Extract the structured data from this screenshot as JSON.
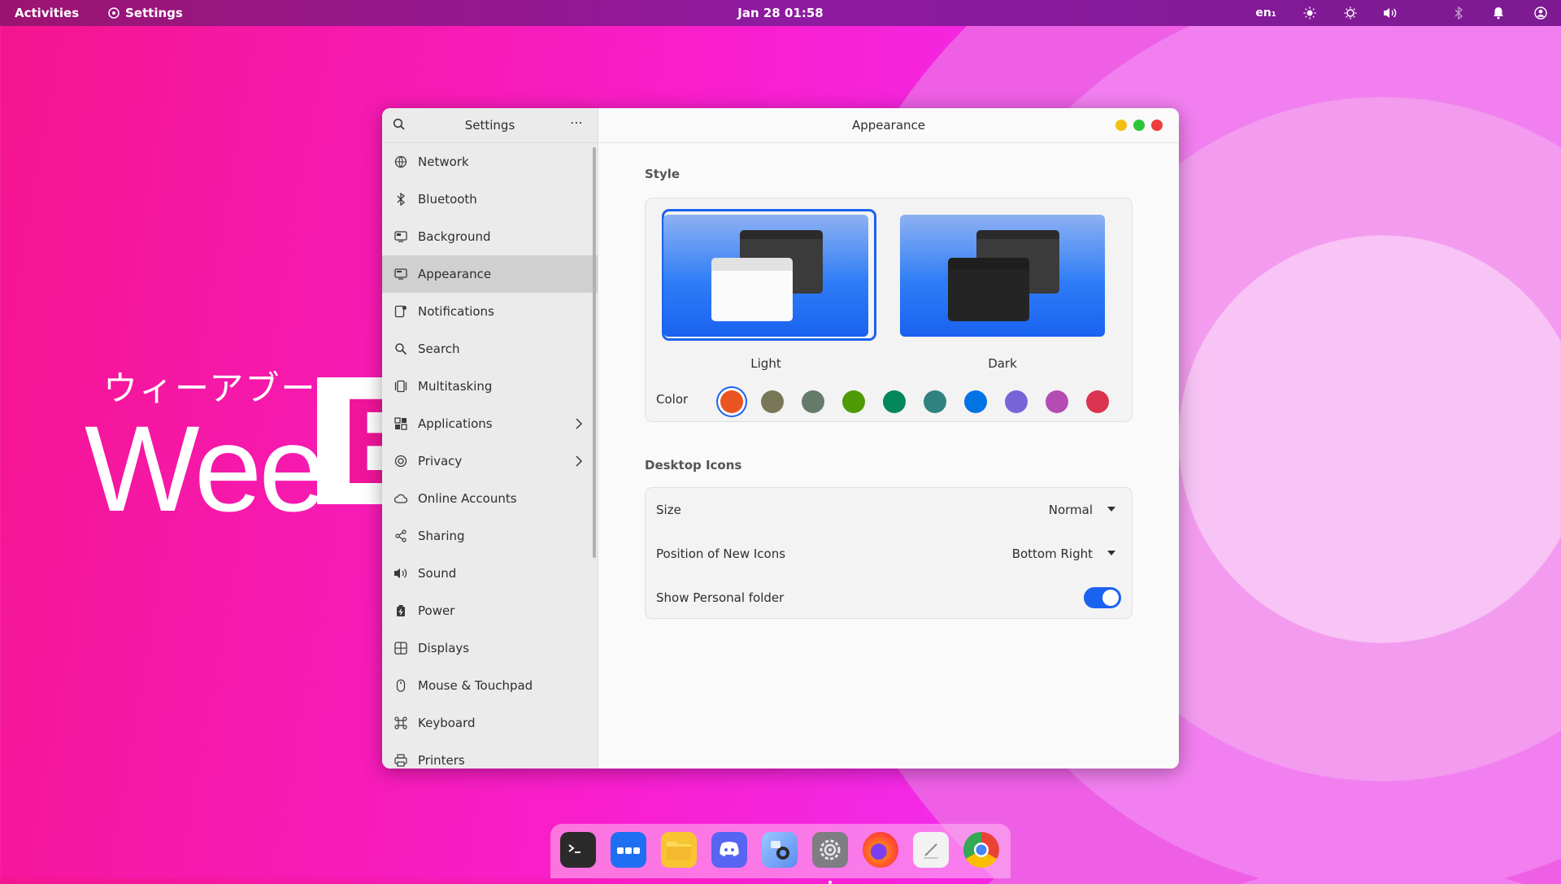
{
  "topbar": {
    "activities": "Activities",
    "app_name": "Settings",
    "clock": "Jan 28  01:58",
    "input_method": "en₁"
  },
  "wallpaper": {
    "jp_text": "ウィーアブー",
    "main_text": "Wee",
    "b_letter": "B"
  },
  "sidebar": {
    "title": "Settings",
    "menu_glyph": "⋯",
    "items": [
      {
        "label": "Network",
        "icon": "network-icon"
      },
      {
        "label": "Bluetooth",
        "icon": "bluetooth-icon"
      },
      {
        "label": "Background",
        "icon": "background-icon"
      },
      {
        "label": "Appearance",
        "icon": "appearance-icon",
        "selected": true
      },
      {
        "label": "Notifications",
        "icon": "notifications-icon"
      },
      {
        "label": "Search",
        "icon": "search-icon"
      },
      {
        "label": "Multitasking",
        "icon": "multitasking-icon"
      },
      {
        "label": "Applications",
        "icon": "applications-icon",
        "arrow": true
      },
      {
        "label": "Privacy",
        "icon": "privacy-icon",
        "arrow": true
      },
      {
        "label": "Online Accounts",
        "icon": "cloud-icon"
      },
      {
        "label": "Sharing",
        "icon": "share-icon"
      },
      {
        "label": "Sound",
        "icon": "speaker-icon"
      },
      {
        "label": "Power",
        "icon": "power-icon"
      },
      {
        "label": "Displays",
        "icon": "display-icon"
      },
      {
        "label": "Mouse & Touchpad",
        "icon": "mouse-icon"
      },
      {
        "label": "Keyboard",
        "icon": "keyboard-icon"
      },
      {
        "label": "Printers",
        "icon": "printer-icon"
      }
    ]
  },
  "content": {
    "title": "Appearance",
    "style_section": "Style",
    "style_options": {
      "light": "Light",
      "dark": "Dark",
      "selected": "light"
    },
    "color_label": "Color",
    "colors": [
      "#e95420",
      "#787859",
      "#657b69",
      "#4e9a06",
      "#03875b",
      "#308280",
      "#0073e5",
      "#7764d8",
      "#b34cb3",
      "#da3450"
    ],
    "selected_color": 0,
    "desktop_icons_section": "Desktop Icons",
    "size_label": "Size",
    "size_value": "Normal",
    "position_label": "Position of New Icons",
    "position_value": "Bottom Right",
    "personal_folder_label": "Show Personal folder",
    "personal_folder_on": true
  },
  "dock": {
    "items": [
      "terminal",
      "app-grid",
      "files",
      "discord",
      "screenshot",
      "settings",
      "firefox",
      "text-editor",
      "chrome"
    ],
    "active": "settings",
    "colors": {
      "accent": "#1a62f0",
      "dock_bg": "#ffbef0"
    }
  }
}
